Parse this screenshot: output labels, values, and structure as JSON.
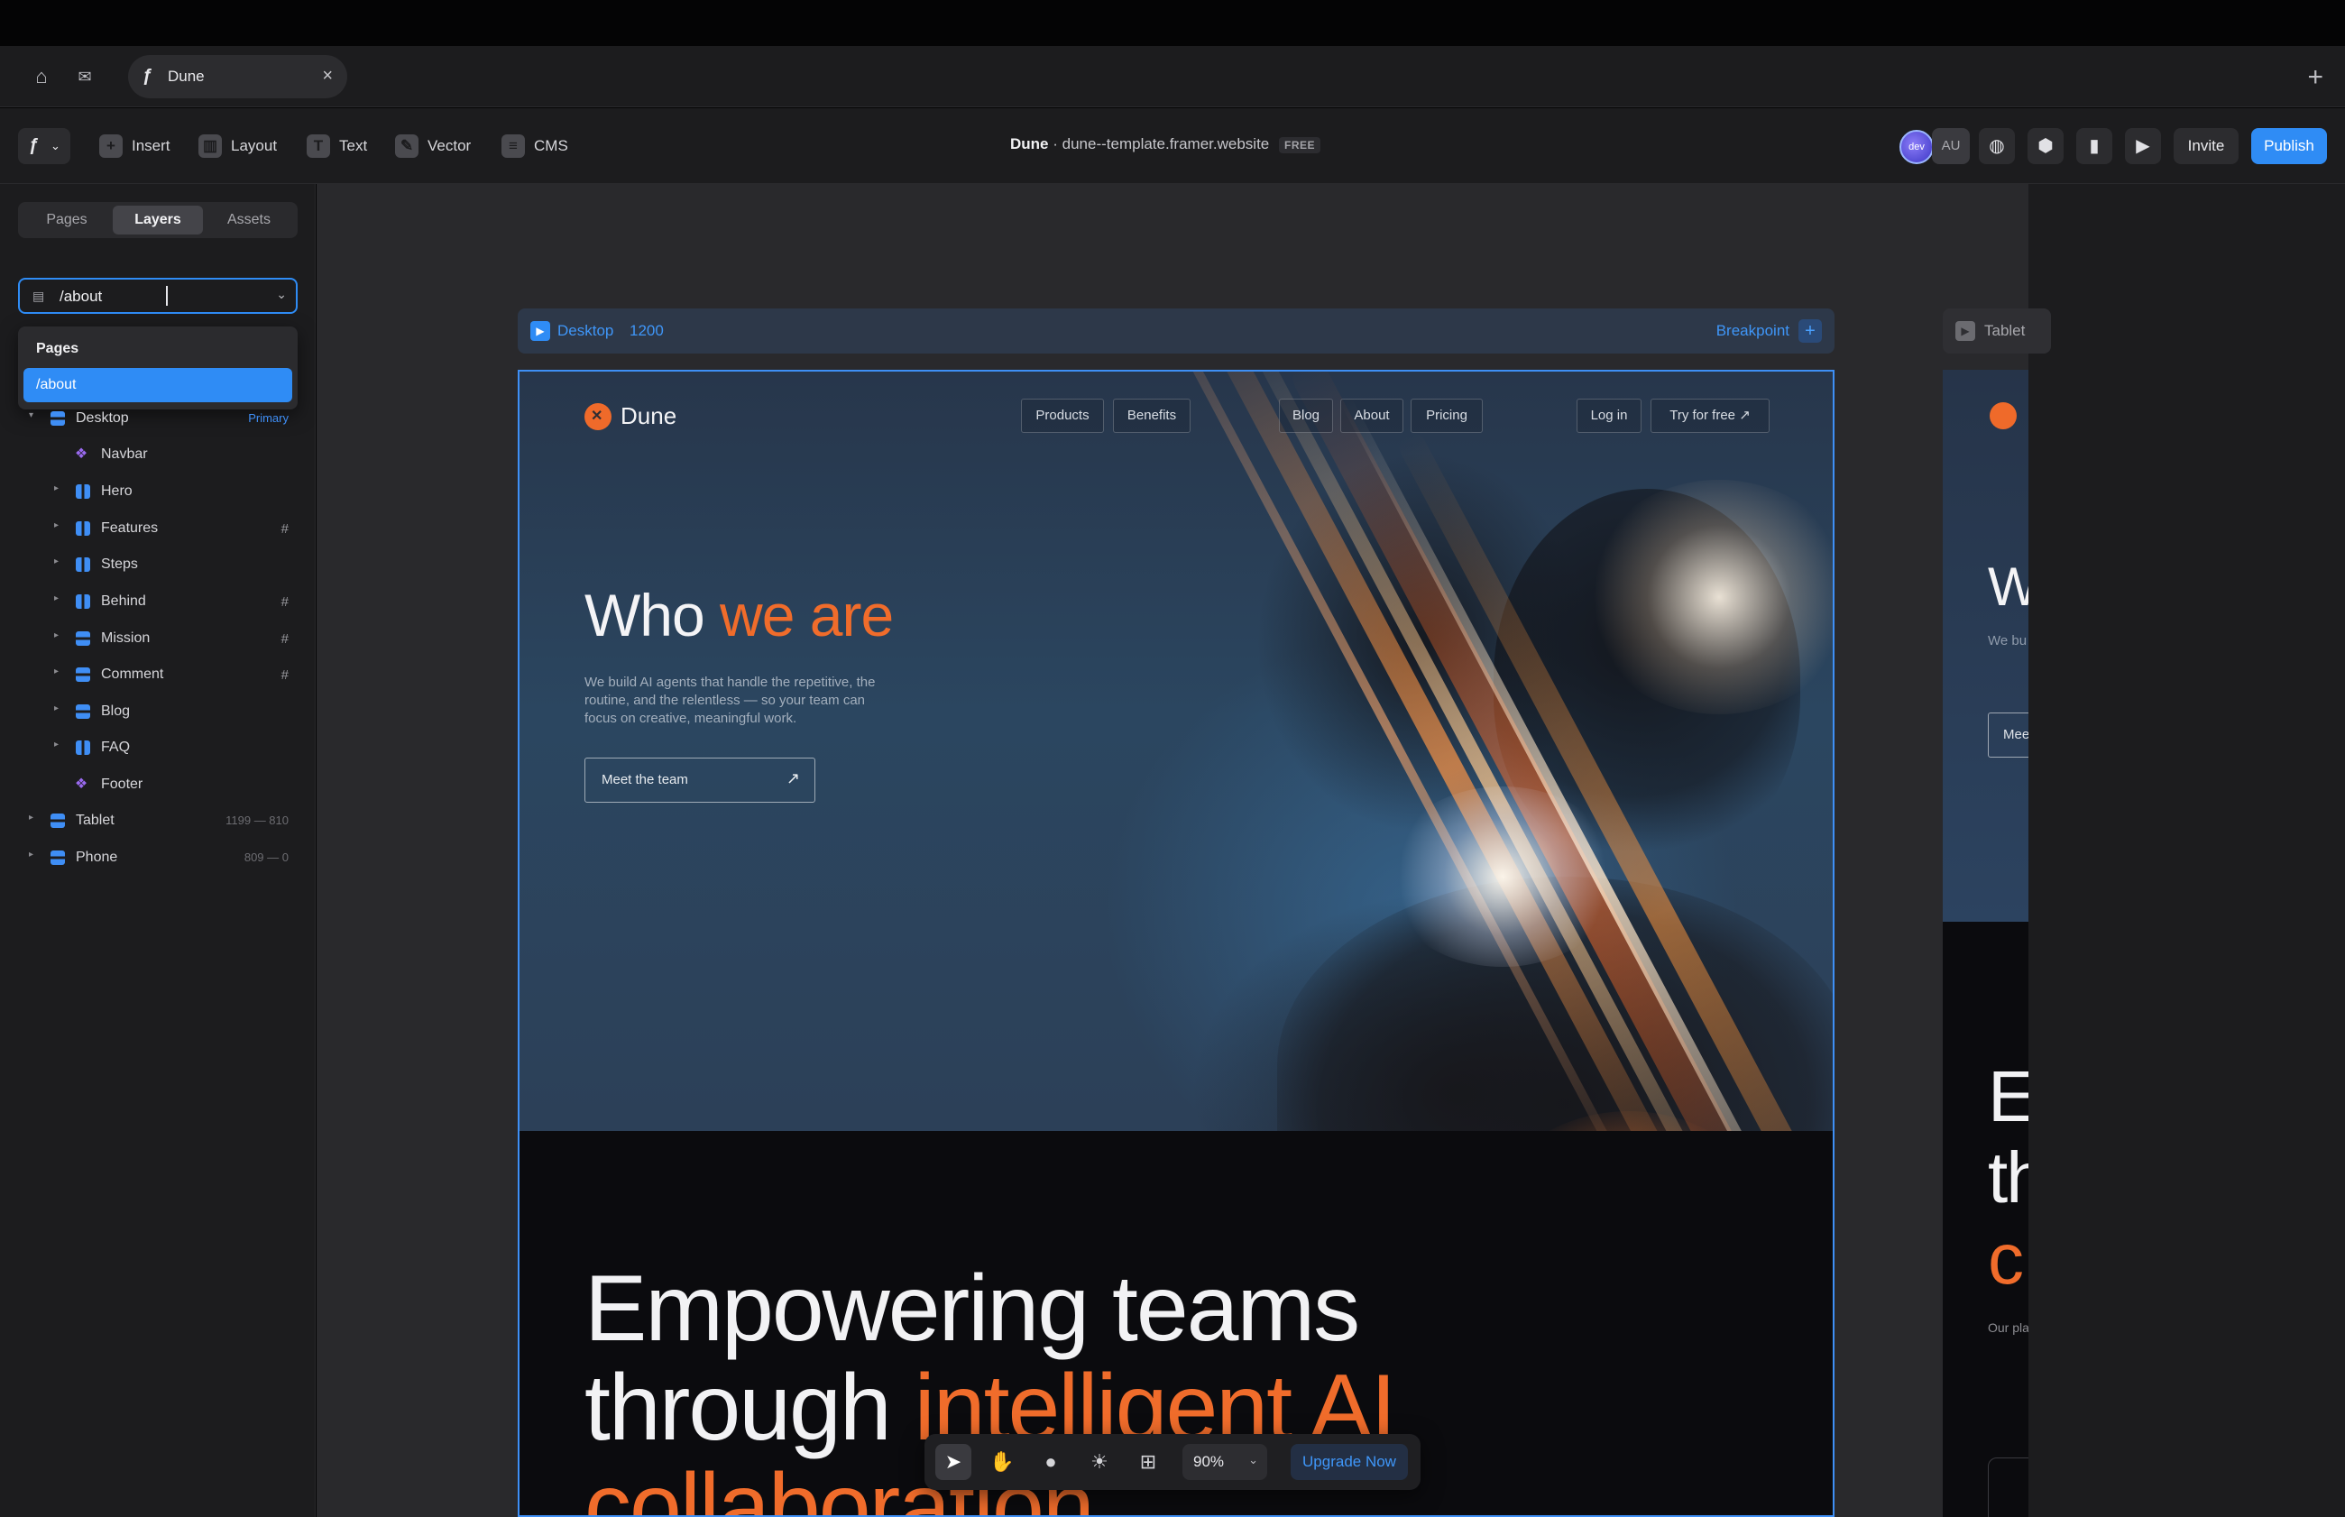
{
  "tab": {
    "title": "Dune",
    "close": "×",
    "new": "+"
  },
  "toolbar": {
    "insert": "Insert",
    "layout": "Layout",
    "text": "Text",
    "vector": "Vector",
    "cms": "CMS",
    "project_name": "Dune",
    "separator": "·",
    "project_url": "dune--template.framer.website",
    "plan_badge": "FREE",
    "avatar_dev": "dev",
    "avatar_au": "AU",
    "invite": "Invite",
    "publish": "Publish"
  },
  "left_panel": {
    "tabs": [
      "Pages",
      "Layers",
      "Assets"
    ],
    "active_tab": "Layers",
    "page_select_value": "/about",
    "dropdown_header": "Pages",
    "dropdown_option": "/about",
    "layers": [
      {
        "label": "Desktop",
        "meta": "Primary"
      },
      {
        "label": "Navbar",
        "meta": ""
      },
      {
        "label": "Hero",
        "meta": ""
      },
      {
        "label": "Features",
        "meta": "#"
      },
      {
        "label": "Steps",
        "meta": ""
      },
      {
        "label": "Behind",
        "meta": "#"
      },
      {
        "label": "Mission",
        "meta": "#"
      },
      {
        "label": "Comment",
        "meta": "#"
      },
      {
        "label": "Blog",
        "meta": ""
      },
      {
        "label": "FAQ",
        "meta": ""
      },
      {
        "label": "Footer",
        "meta": ""
      },
      {
        "label": "Tablet",
        "meta": "1199 — 810"
      },
      {
        "label": "Phone",
        "meta": "809 — 0"
      }
    ]
  },
  "canvas": {
    "desktop_label": "Desktop",
    "desktop_width": "1200",
    "breakpoint": "Breakpoint",
    "tablet_label": "Tablet",
    "site": {
      "brand": "Dune",
      "nav": [
        "Products",
        "Benefits",
        "Blog",
        "About",
        "Pricing"
      ],
      "login": "Log in",
      "cta": "Try for free ↗",
      "hero_title_a": "Who ",
      "hero_title_b": "we are",
      "hero_desc": "We build AI agents that handle the repetitive, the routine, and the relentless — so your team can focus on creative, meaningful work.",
      "hero_button": "Meet the team",
      "big_line1": "Empowering teams",
      "big_line2_a": "through ",
      "big_line2_b": "intelligent AI",
      "big_line3": "collaboration"
    },
    "tablet": {
      "head": "W",
      "desc": "We bu the rou can fo",
      "btn": "Mee",
      "big1": "E",
      "big2": "th",
      "big3": "c",
      "small": "Our pla teams collabo repetit"
    }
  },
  "bottom_toolbar": {
    "zoom": "90%",
    "upgrade": "Upgrade Now"
  },
  "colors": {
    "accent_blue": "#2f8cf5",
    "accent_orange": "#f06c2b"
  }
}
